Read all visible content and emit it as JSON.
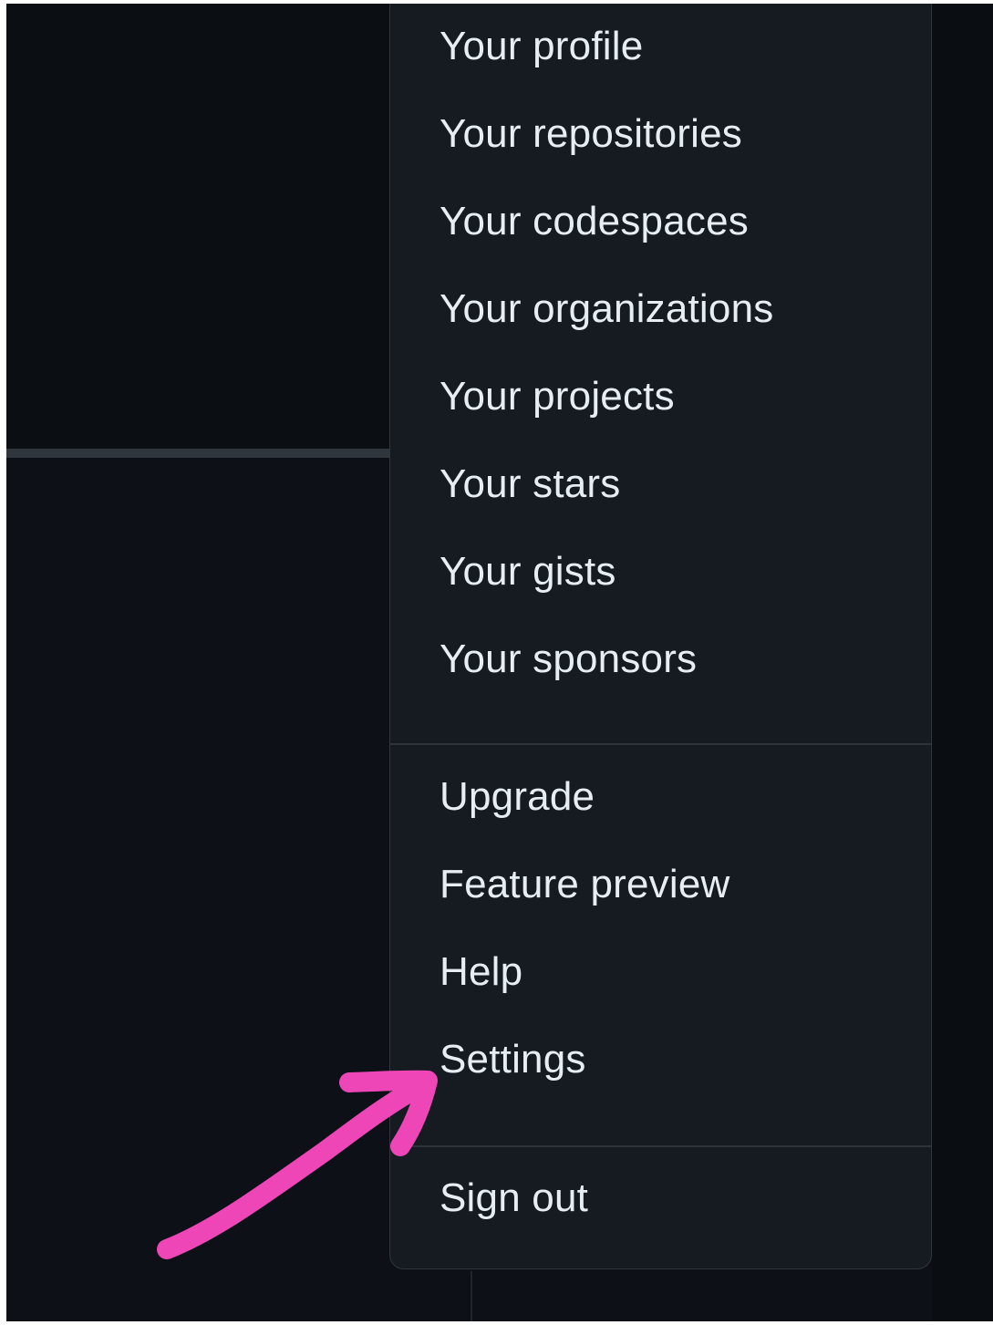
{
  "menu": {
    "items": [
      {
        "label": "Your profile"
      },
      {
        "label": "Your repositories"
      },
      {
        "label": "Your codespaces"
      },
      {
        "label": "Your organizations"
      },
      {
        "label": "Your projects"
      },
      {
        "label": "Your stars"
      },
      {
        "label": "Your gists"
      },
      {
        "label": "Your sponsors"
      },
      {
        "label": "Upgrade"
      },
      {
        "label": "Feature preview"
      },
      {
        "label": "Help"
      },
      {
        "label": "Settings"
      },
      {
        "label": "Sign out"
      }
    ]
  },
  "annotation": {
    "icon": "arrow-icon",
    "color": "#ee46b7",
    "target": "Settings"
  },
  "colors": {
    "menu_background": "#161b22",
    "page_background": "#0d1117",
    "text": "#e6edf3"
  }
}
